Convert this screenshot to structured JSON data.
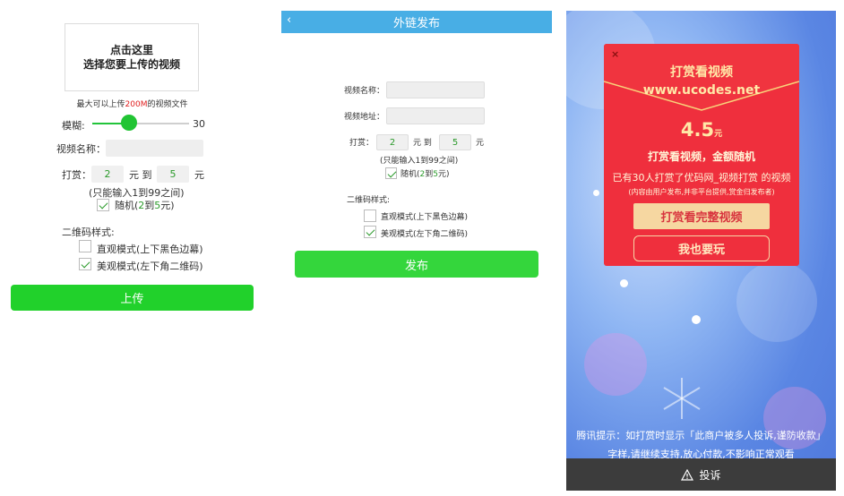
{
  "panel1": {
    "upload_line1": "点击这里",
    "upload_line2": "选择您要上传的视频",
    "max_prefix": "最大可以上传",
    "max_size": "200M",
    "max_suffix": "的视频文件",
    "blur_label": "模糊:",
    "blur_value": "30",
    "blur_level_percent": 38,
    "name_label": "视频名称：",
    "reward_label": "打赏：",
    "reward_min": "2",
    "yuan_to": "元 到",
    "reward_max": "5",
    "yuan": "元",
    "hint": "(只能输入1到99之间)",
    "random_label_prefix": "随机(",
    "random_a": "2",
    "random_mid": "到",
    "random_b": "5",
    "random_suffix": "元)",
    "qr_title": "二维码样式:",
    "mode1": "直观模式(上下黑色边幕)",
    "mode2": "美观模式(左下角二维码)",
    "mode1_checked": false,
    "mode2_checked": true,
    "submit": "上传"
  },
  "panel2": {
    "back_icon": "chevron-left-icon",
    "title": "外链发布",
    "name_label": "视频名称：",
    "url_label": "视频地址：",
    "reward_label": "打赏：",
    "reward_min": "2",
    "yuan_to": "元 到",
    "reward_max": "5",
    "yuan": "元",
    "hint": "(只能输入1到99之间)",
    "random_label_prefix": "随机(",
    "random_a": "2",
    "random_mid": "到",
    "random_b": "5",
    "random_suffix": "元)",
    "qr_title": "二维码样式:",
    "mode1": "直观模式(上下黑色边幕)",
    "mode2": "美观模式(左下角二维码)",
    "submit": "发布"
  },
  "panel3": {
    "close": "×",
    "title1": "打赏看视频",
    "title2": "www.ucodes.net",
    "amount": "4.5",
    "amount_unit": "元",
    "line1": "打赏看视频，金额随机",
    "line2": "已有30人打赏了优码网_视频打赏 的视频",
    "line3": "(内容由用户发布,并非平台提供,赏金归发布者)",
    "button1": "打赏看完整视频",
    "button2": "我也要玩",
    "tip1": "腾讯提示：如打赏时显示「此商户被多人投诉,谨防收款」",
    "tip2": "字样,请继续支持,放心付款,不影响正常观看",
    "report": "投诉",
    "colors": {
      "card": "#ef2f3d",
      "gold": "#f6d7a1",
      "accent": "#21d12b",
      "header": "#48aee5"
    }
  }
}
